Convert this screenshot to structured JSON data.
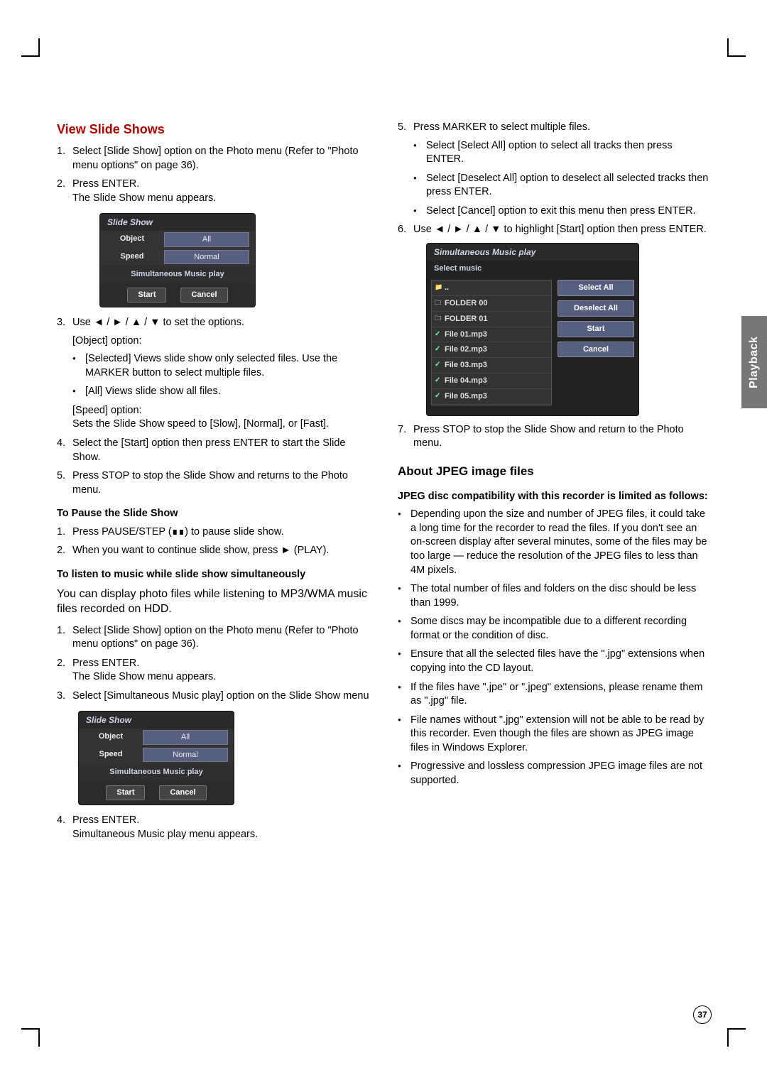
{
  "sidetab": "Playback",
  "pagenum": "37",
  "left": {
    "h1": "View Slide Shows",
    "ol1": [
      "Select [Slide Show] option on the Photo menu (Refer to \"Photo menu options\" on page 36).",
      "Press ENTER."
    ],
    "ol1_sub": "The Slide Show menu appears.",
    "ss_ui": {
      "title": "Slide Show",
      "object_label": "Object",
      "object_value": "All",
      "speed_label": "Speed",
      "speed_value": "Normal",
      "smp": "Simultaneous Music play",
      "start": "Start",
      "cancel": "Cancel"
    },
    "ol2_3a": "Use ◄ / ► / ▲ / ▼ to set the options.",
    "ol2_3b": "[Object] option:",
    "ol2_3_bullets": [
      "[Selected] Views slide show only selected files. Use the MARKER button to select multiple files.",
      "[All] Views slide show all files."
    ],
    "ol2_3c": "[Speed] option:",
    "ol2_3d": "Sets the Slide Show speed to [Slow], [Normal], or [Fast].",
    "ol2_4": "Select the [Start] option then press ENTER to start the Slide Show.",
    "ol2_5": "Press STOP to stop the Slide Show and returns to the Photo menu.",
    "h3a": "To Pause the Slide Show",
    "pause1": "Press PAUSE/STEP (∎∎) to pause slide show.",
    "pause2": "When you want to continue slide show, press ► (PLAY).",
    "h3b": "To listen to music while slide show simultaneously",
    "intro": "You can display photo files while listening to MP3/WMA music files recorded on HDD.",
    "ol3": [
      "Select [Slide Show] option on the Photo menu (Refer to \"Photo menu options\" on page 36).",
      "Press ENTER."
    ],
    "ol3_sub": "The Slide Show menu appears.",
    "ol3_3": "Select [Simultaneous Music play] option on the Slide Show menu",
    "ol3_4a": "Press ENTER.",
    "ol3_4b": "Simultaneous Music play menu appears."
  },
  "right": {
    "ol5a": "Press MARKER to select multiple files.",
    "ol5_bullets": [
      "Select [Select All] option to select all tracks then press ENTER.",
      "Select [Deselect All] option to deselect all selected tracks then press ENTER.",
      "Select [Cancel] option to exit this menu then press ENTER."
    ],
    "ol6": "Use ◄ / ► / ▲ / ▼ to highlight [Start] option then press ENTER.",
    "music_ui": {
      "title": "Simultaneous Music play",
      "select_music": "Select  music",
      "items_up": "..",
      "folders": [
        "FOLDER 00",
        "FOLDER 01"
      ],
      "files": [
        "File 01.mp3",
        "File 02.mp3",
        "File 03.mp3",
        "File 04.mp3",
        "File 05.mp3"
      ],
      "btn_select_all": "Select All",
      "btn_deselect_all": "Deselect All",
      "btn_start": "Start",
      "btn_cancel": "Cancel",
      "footer_hint": ""
    },
    "ol7": "Press STOP to stop the Slide Show and return to the Photo menu.",
    "h2": "About JPEG image files",
    "h3": "JPEG disc compatibility with this recorder is limited as follows:",
    "bullets": [
      "Depending upon the size and number of JPEG files, it could take a long time for the recorder to read the files. If you don't see an on-screen display after several minutes, some of the files may be too large — reduce the resolution of the JPEG files to less than 4M pixels.",
      "The total number of files and folders on the disc should be less than 1999.",
      "Some discs may be incompatible due to a different recording format or the condition of disc.",
      "Ensure that all the selected files have the \".jpg\" extensions when copying into the CD layout.",
      "If the files have \".jpe\" or \".jpeg\" extensions, please rename them as \".jpg\" file.",
      "File names without \".jpg\" extension will not be able to be read by this recorder. Even though the files are shown as JPEG image files in Windows Explorer.",
      "Progressive and lossless compression JPEG image files are not supported."
    ]
  }
}
